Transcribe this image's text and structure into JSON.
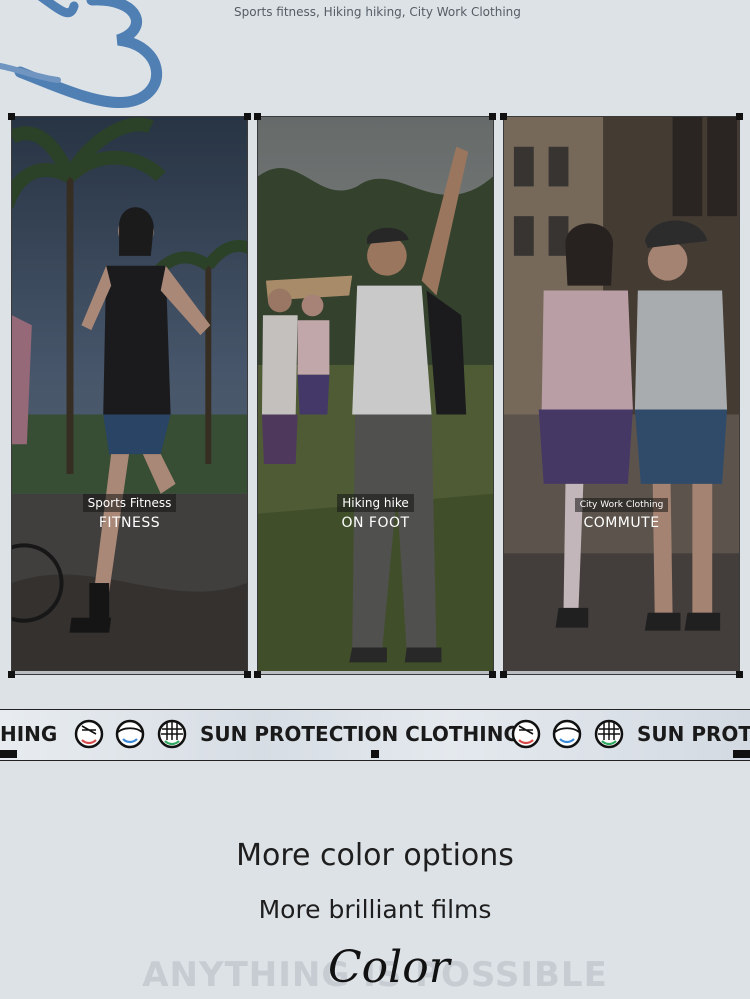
{
  "header": {
    "subtitle": "Sports fitness, Hiking hiking, City Work Clothing",
    "logo_icon": "brush-stroke-logo"
  },
  "panels": [
    {
      "small_label": "Sports Fitness",
      "big_label": "FITNESS"
    },
    {
      "small_label": "Hiking hike",
      "big_label": "ON FOOT"
    },
    {
      "small_label": "City Work Clothing",
      "big_label": "COMMUTE"
    }
  ],
  "ticker": {
    "partial_left": "HING",
    "main_text": "SUN PROTECTION CLOTHING",
    "partial_right": "SUN PROTE",
    "icons": [
      "sun-face-icon",
      "face-shield-icon",
      "mesh-fabric-icon"
    ]
  },
  "section": {
    "title": "More color options",
    "subtitle": "More brilliant films",
    "ghost_text": "ANYTHING IS POSSIBLE",
    "script_text": "Color"
  },
  "colors": {
    "background": "#dde2e7",
    "accent_blue": "#4f7fb3",
    "text_dark": "#1e1e1e"
  }
}
